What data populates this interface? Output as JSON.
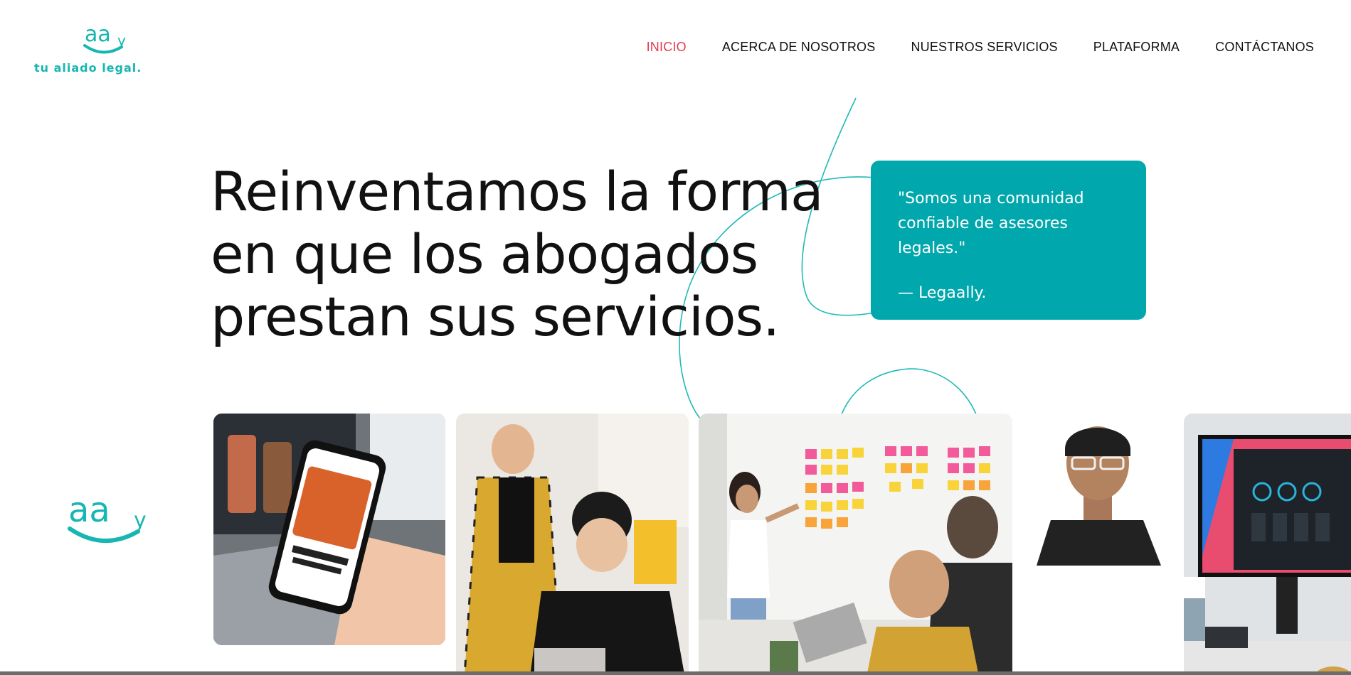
{
  "brand": {
    "tagline": "tu aliado legal.",
    "accent_color": "#17b6b2"
  },
  "nav": {
    "items": [
      {
        "label": "INICIO",
        "active": true
      },
      {
        "label": "ACERCA DE NOSOTROS",
        "active": false
      },
      {
        "label": "NUESTROS SERVICIOS",
        "active": false
      },
      {
        "label": "PLATAFORMA",
        "active": false
      },
      {
        "label": "CONTÁCTANOS",
        "active": false
      }
    ],
    "active_color": "#e63b4d"
  },
  "hero": {
    "title_lines": [
      "Reinventamos la forma",
      "en que los abogados",
      "prestan sus servicios."
    ]
  },
  "quote": {
    "text": "\"Somos una comunidad confiable de asesores legales.\"",
    "author": "— Legaally.",
    "background": "#00a7ac"
  },
  "photos": [
    {
      "name": "phone-app-photo",
      "description_icon": "smartphone-image"
    },
    {
      "name": "team-laptop-photo",
      "description_icon": "people-image"
    },
    {
      "name": "sticky-notes-meeting-photo",
      "description_icon": "meeting-image"
    },
    {
      "name": "portrait-man-photo",
      "description_icon": "person-image"
    },
    {
      "name": "desktop-monitor-photo",
      "description_icon": "monitor-image"
    }
  ]
}
